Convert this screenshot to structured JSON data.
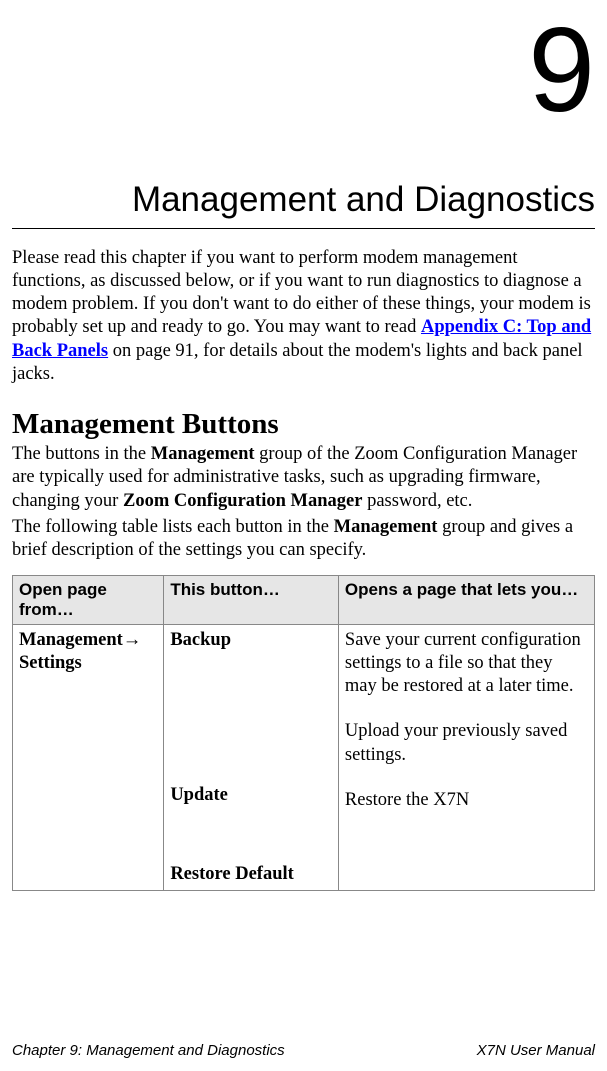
{
  "chapter_number": "9",
  "chapter_title": "Management and Diagnostics",
  "intro": {
    "prefix": "Please read this chapter if you want to perform modem management functions, as discussed below, or if you want to run diagnostics to diagnose a modem problem.  If you don't want to do either of these things, your modem is probably set up and ready to go. You may want to read ",
    "link_text": "Appendix C: Top and Back Panels",
    "suffix": " on page 91, for details about the modem's lights and back panel jacks."
  },
  "section_heading": "Management Buttons",
  "para1": {
    "t1": "The buttons in the ",
    "b1": "Management",
    "t2": " group of the Zoom Configuration Manager are typically used for administrative tasks, such as upgrading firmware, changing your ",
    "b2": "Zoom Configuration Manager",
    "t3": " password, etc."
  },
  "para2": {
    "t1": "The following table lists each button in the ",
    "b1": "Management",
    "t2": " group and gives a brief description of the settings you can specify."
  },
  "table": {
    "headers": {
      "h1": "Open page from…",
      "h2": "This button…",
      "h3": "Opens a page that lets you…"
    },
    "row1": {
      "open_from_prefix": "Management",
      "open_from_arrow": "→",
      "open_from_suffix": "Settings",
      "buttons": {
        "b1": "Backup",
        "b2": "Update",
        "b3": "Restore Default"
      },
      "descs": {
        "d1": "Save your current configuration settings to a file so that they may be restored at a later time.",
        "d2": "Upload your previously saved settings.",
        "d3": "Restore the X7N"
      }
    }
  },
  "footer": {
    "left": "Chapter 9: Management and Diagnostics",
    "right": "X7N User Manual"
  }
}
